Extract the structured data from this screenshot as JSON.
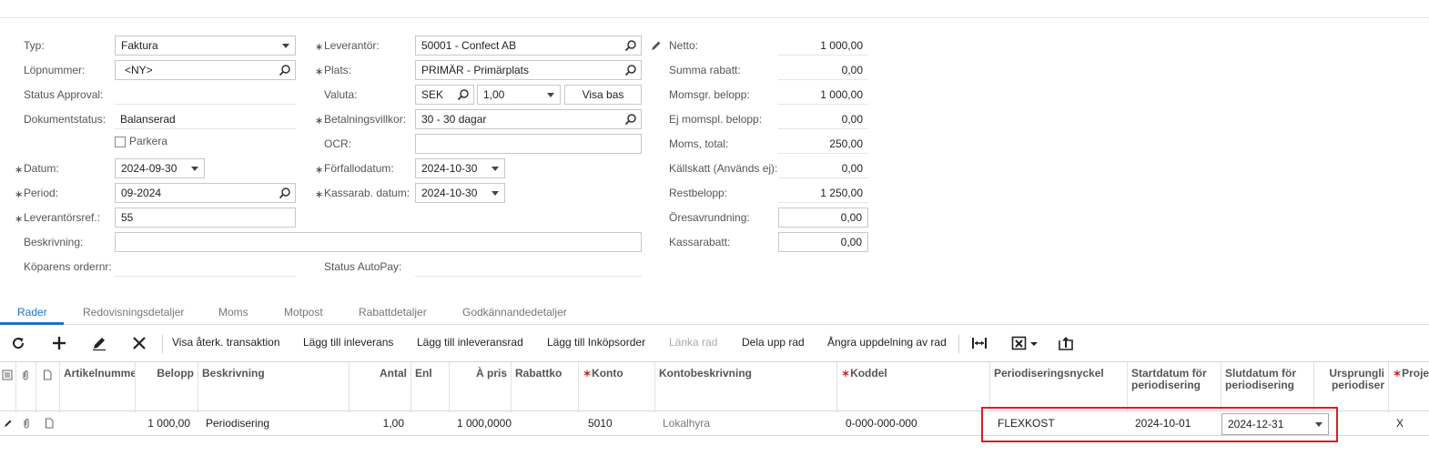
{
  "form": {
    "type_label": "Typ:",
    "type_value": "Faktura",
    "ref_label": "Löpnummer:",
    "ref_value": "<NY>",
    "approval_label": "Status Approval:",
    "docstatus_label": "Dokumentstatus:",
    "docstatus_value": "Balanserad",
    "hold_label": "Parkera",
    "date_label": "Datum:",
    "date_value": "2024-09-30",
    "period_label": "Period:",
    "period_value": "09-2024",
    "vendorref_label": "Leverantörsref.:",
    "vendorref_value": "55",
    "desc_label": "Beskrivning:",
    "desc_value": "",
    "buyer_order_label": "Köparens ordernr:",
    "vendor_label": "Leverantör:",
    "vendor_value": "50001 - Confect AB",
    "location_label": "Plats:",
    "location_value": "PRIMÄR - Primärplats",
    "currency_label": "Valuta:",
    "currency_value": "SEK",
    "rate_value": "1,00",
    "view_base_label": "Visa bas",
    "terms_label": "Betalningsvillkor:",
    "terms_value": "30 - 30 dagar",
    "ocr_label": "OCR:",
    "ocr_value": "",
    "due_label": "Förfallodatum:",
    "due_value": "2024-10-30",
    "cashdisc_label": "Kassarab. datum:",
    "cashdisc_value": "2024-10-30",
    "autopay_label": "Status AutoPay:"
  },
  "totals": {
    "net_label": "Netto:",
    "net_value": "1 000,00",
    "discount_label": "Summa rabatt:",
    "discount_value": "0,00",
    "taxable_label": "Momsgr. belopp:",
    "taxable_value": "1 000,00",
    "exempt_label": "Ej momspl. belopp:",
    "exempt_value": "0,00",
    "tax_label": "Moms, total:",
    "tax_value": "250,00",
    "withholding_label": "Källskatt (Används ej):",
    "withholding_value": "0,00",
    "balance_label": "Restbelopp:",
    "balance_value": "1 250,00",
    "rounding_label": "Öresavrundning:",
    "rounding_value": "0,00",
    "cashdiscount_label": "Kassarabatt:",
    "cashdiscount_value": "0,00"
  },
  "tabs": [
    "Rader",
    "Redovisningsdetaljer",
    "Moms",
    "Motpost",
    "Rabattdetaljer",
    "Godkännandedetaljer"
  ],
  "toolbar": {
    "view_tx": "Visa återk. transaktion",
    "add_receipt": "Lägg till inleverans",
    "add_receipt_line": "Lägg till inleveransrad",
    "add_po": "Lägg till Inköpsorder",
    "link_line": "Länka rad",
    "split_line": "Dela upp rad",
    "undo_split": "Ångra uppdelning av rad"
  },
  "grid": {
    "headers": {
      "item": "Artikelnummer",
      "amount": "Belopp",
      "desc": "Beskrivning",
      "qty": "Antal",
      "uom": "Enl",
      "price": "À pris",
      "disc": "Rabattko",
      "account": "Konto",
      "account_desc": "Kontobeskrivning",
      "sub": "Koddel",
      "deferral": "Periodiseringsnyckel",
      "start": "Startdatum för periodisering",
      "end": "Slutdatum för periodisering",
      "orig": "Ursprungli periodiser",
      "project": "Proje"
    },
    "row": {
      "amount": "1 000,00",
      "desc": "Periodisering",
      "qty": "1,00",
      "price": "1 000,0000",
      "account": "5010",
      "account_desc": "Lokalhyra",
      "sub": "0-000-000-000",
      "deferral": "FLEXKOST",
      "start": "2024-10-01",
      "end": "2024-12-31",
      "project": "X"
    }
  }
}
